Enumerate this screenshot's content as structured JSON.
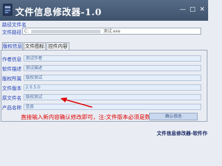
{
  "window": {
    "title": "文件信息修改器-1.0",
    "minimize_glyph": "—",
    "maximize_glyph": "□",
    "close_glyph": "✕"
  },
  "path_group": {
    "label": "路径文件名",
    "file_path_label": "文件路径",
    "file_path_prefix": "C:",
    "file_path_suffix": "测试.exe"
  },
  "tabs": [
    {
      "label": "版权信息",
      "active": true
    },
    {
      "label": "文件图标",
      "active": false
    },
    {
      "label": "控件内容",
      "active": false
    }
  ],
  "fields": [
    {
      "label": "作者信息",
      "value": "测试作者"
    },
    {
      "label": "软件描述",
      "value": "测试描述"
    },
    {
      "label": "版权所属",
      "value": "版权测试"
    },
    {
      "label": "文件版本",
      "value": "2.0.5.0"
    },
    {
      "label": "原文件名",
      "value": "版权测试"
    },
    {
      "label": "产品名称",
      "value": "信息"
    }
  ],
  "hint": "直接输入新内容确认修改即可，注:文件版本必须是数值",
  "confirm_button_label": "确认修改",
  "footer": "文件信息修改器-软件作",
  "colors": {
    "title_bar": "#4a5e78",
    "label_blue": "#2440b8",
    "hint_red": "#e00000",
    "input_fill": "#e4eefb"
  }
}
